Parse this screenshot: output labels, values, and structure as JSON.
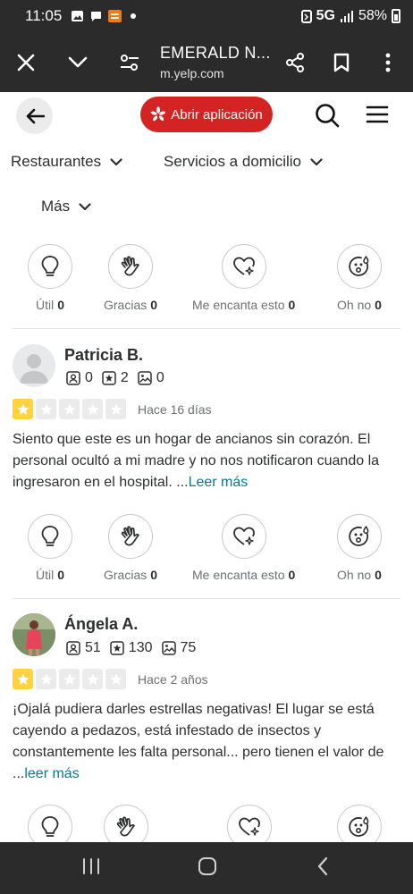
{
  "status_bar": {
    "time": "11:05",
    "network": "5G",
    "battery": "58%"
  },
  "browser": {
    "title": "EMERALD N...",
    "url": "m.yelp.com"
  },
  "header": {
    "open_app_label": "Abrir aplicación"
  },
  "nav": {
    "restaurants": "Restaurantes",
    "delivery": "Servicios a domicilio",
    "more": "Más"
  },
  "reactions_top": {
    "useful_label": "Útil",
    "useful_count": "0",
    "thanks_label": "Gracias",
    "thanks_count": "0",
    "love_label": "Me encanta esto",
    "love_count": "0",
    "ohno_label": "Oh no",
    "ohno_count": "0"
  },
  "reviews": [
    {
      "name": "Patricia B.",
      "friends": "0",
      "reviews": "2",
      "photos": "0",
      "rating": 1,
      "date": "Hace 16 días",
      "text": "Siento que este es un hogar de ancianos sin corazón. El personal ocultó a mi madre y no nos notificaron cuando la ingresaron en el hospital. ...",
      "read_more": "Leer más",
      "reactions": {
        "useful_label": "Útil",
        "useful_count": "0",
        "thanks_label": "Gracias",
        "thanks_count": "0",
        "love_label": "Me encanta esto",
        "love_count": "0",
        "ohno_label": "Oh no",
        "ohno_count": "0"
      }
    },
    {
      "name": "Ángela A.",
      "friends": "51",
      "reviews": "130",
      "photos": "75",
      "rating": 1,
      "date": "Hace 2 años",
      "text": "¡Ojalá pudiera darles estrellas negativas! El lugar se está cayendo a pedazos, está infestado de insectos y constantemente les falta personal... pero tienen el va­lor de ...",
      "read_more": "leer más"
    }
  ],
  "colors": {
    "brand_red": "#d32323",
    "star_yellow": "#ffd23e",
    "link_teal": "#027a97"
  }
}
